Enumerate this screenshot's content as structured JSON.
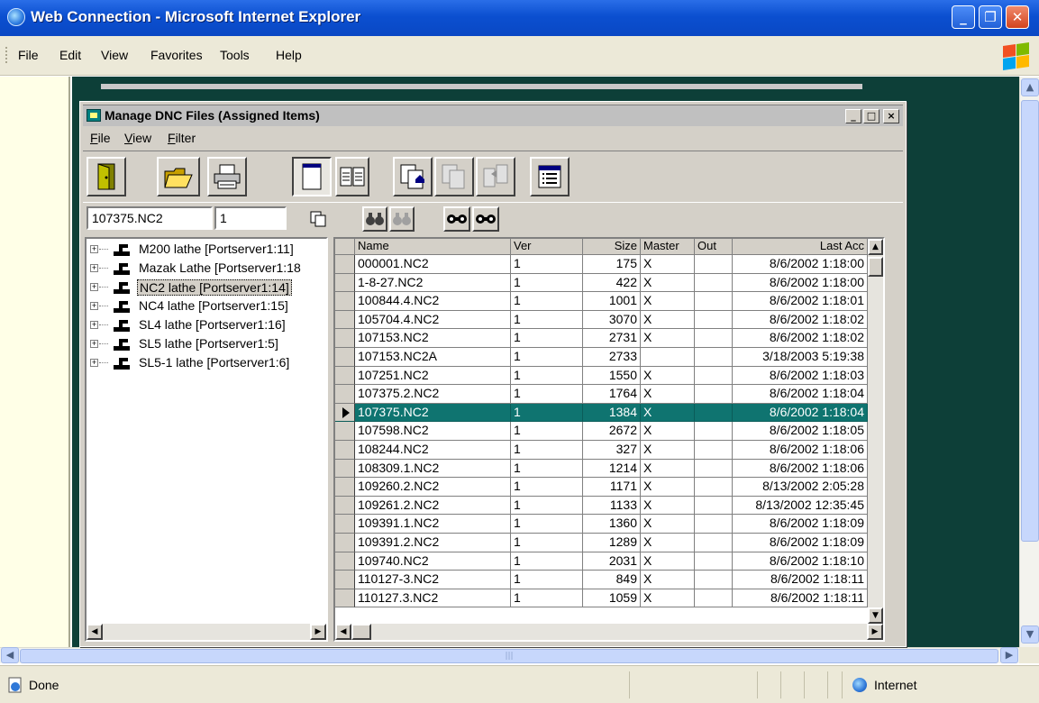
{
  "browser": {
    "title": "Web Connection - Microsoft Internet Explorer",
    "menu": [
      "File",
      "Edit",
      "View",
      "Favorites",
      "Tools",
      "Help"
    ],
    "status_text": "Done",
    "zone": "Internet"
  },
  "app": {
    "title": "Manage DNC Files (Assigned Items)",
    "menu": [
      {
        "label": "File",
        "key": "F",
        "rest": "ile"
      },
      {
        "label": "View",
        "key": "V",
        "rest": "iew"
      },
      {
        "label": "Filter",
        "key": "F",
        "rest": "ilter"
      }
    ],
    "search": {
      "file": "107375.NC2",
      "version": "1"
    },
    "machines": [
      "M200 lathe [Portserver1:11]",
      "Mazak Lathe [Portserver1:18",
      "NC2 lathe [Portserver1:14]",
      "NC4 lathe [Portserver1:15]",
      "SL4 lathe [Portserver1:16]",
      "SL5 lathe [Portserver1:5]",
      "SL5-1 lathe [Portserver1:6]"
    ],
    "selected_machine": 2,
    "columns": [
      "Name",
      "Ver",
      "Size",
      "Master",
      "Out",
      "Last Acc"
    ],
    "rows": [
      [
        "000001.NC2",
        "1",
        "175",
        "X",
        "",
        "8/6/2002 1:18:00"
      ],
      [
        "1-8-27.NC2",
        "1",
        "422",
        "X",
        "",
        "8/6/2002 1:18:00"
      ],
      [
        "100844.4.NC2",
        "1",
        "1001",
        "X",
        "",
        "8/6/2002 1:18:01"
      ],
      [
        "105704.4.NC2",
        "1",
        "3070",
        "X",
        "",
        "8/6/2002 1:18:02"
      ],
      [
        "107153.NC2",
        "1",
        "2731",
        "X",
        "",
        "8/6/2002 1:18:02"
      ],
      [
        "107153.NC2A",
        "1",
        "2733",
        "",
        "",
        "3/18/2003 5:19:38"
      ],
      [
        "107251.NC2",
        "1",
        "1550",
        "X",
        "",
        "8/6/2002 1:18:03"
      ],
      [
        "107375.2.NC2",
        "1",
        "1764",
        "X",
        "",
        "8/6/2002 1:18:04"
      ],
      [
        "107375.NC2",
        "1",
        "1384",
        "X",
        "",
        "8/6/2002 1:18:04"
      ],
      [
        "107598.NC2",
        "1",
        "2672",
        "X",
        "",
        "8/6/2002 1:18:05"
      ],
      [
        "108244.NC2",
        "1",
        "327",
        "X",
        "",
        "8/6/2002 1:18:06"
      ],
      [
        "108309.1.NC2",
        "1",
        "1214",
        "X",
        "",
        "8/6/2002 1:18:06"
      ],
      [
        "109260.2.NC2",
        "1",
        "1171",
        "X",
        "",
        "8/13/2002 2:05:28"
      ],
      [
        "109261.2.NC2",
        "1",
        "1133",
        "X",
        "",
        "8/13/2002 12:35:45"
      ],
      [
        "109391.1.NC2",
        "1",
        "1360",
        "X",
        "",
        "8/6/2002 1:18:09"
      ],
      [
        "109391.2.NC2",
        "1",
        "1289",
        "X",
        "",
        "8/6/2002 1:18:09"
      ],
      [
        "109740.NC2",
        "1",
        "2031",
        "X",
        "",
        "8/6/2002 1:18:10"
      ],
      [
        "110127-3.NC2",
        "1",
        "849",
        "X",
        "",
        "8/6/2002 1:18:11"
      ],
      [
        "110127.3.NC2",
        "1",
        "1059",
        "X",
        "",
        "8/6/2002 1:18:11"
      ]
    ],
    "selected_row": 8
  },
  "colors": {
    "xp_title": "#0b4fd0",
    "page_bg": "#0d3f38",
    "selection": "#0f7470",
    "face": "#d4d0c8"
  },
  "icons": [
    "exit-door-icon",
    "open-folder-icon",
    "printer-icon",
    "new-document-icon",
    "two-pages-icon",
    "move-file-icon",
    "copy-file-icon",
    "compare-file-icon",
    "list-view-icon",
    "copy-icon",
    "binoculars-icon"
  ]
}
